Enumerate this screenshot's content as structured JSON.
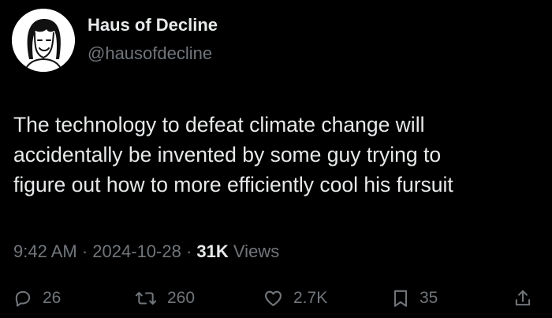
{
  "author": {
    "name": "Haus of Decline",
    "handle": "@hausofdecline",
    "avatar_icon": "cartoon-face-avatar"
  },
  "tweet": {
    "lines": [
      "The technology to defeat climate change will",
      "accidentally be invented by some guy trying to",
      "figure out how to more efficiently cool his fursuit"
    ]
  },
  "meta": {
    "time": "9:42 AM",
    "separator": "·",
    "date": "2024-10-28",
    "views_count": "31K",
    "views_label": "Views"
  },
  "actions": {
    "reply": {
      "icon": "reply-icon",
      "count": "26"
    },
    "retweet": {
      "icon": "retweet-icon",
      "count": "260"
    },
    "like": {
      "icon": "heart-icon",
      "count": "2.7K"
    },
    "bookmark": {
      "icon": "bookmark-icon",
      "count": "35"
    },
    "share": {
      "icon": "share-icon"
    }
  },
  "colors": {
    "background": "#000000",
    "primary_text": "#e7e9ea",
    "secondary_text": "#71767b"
  }
}
